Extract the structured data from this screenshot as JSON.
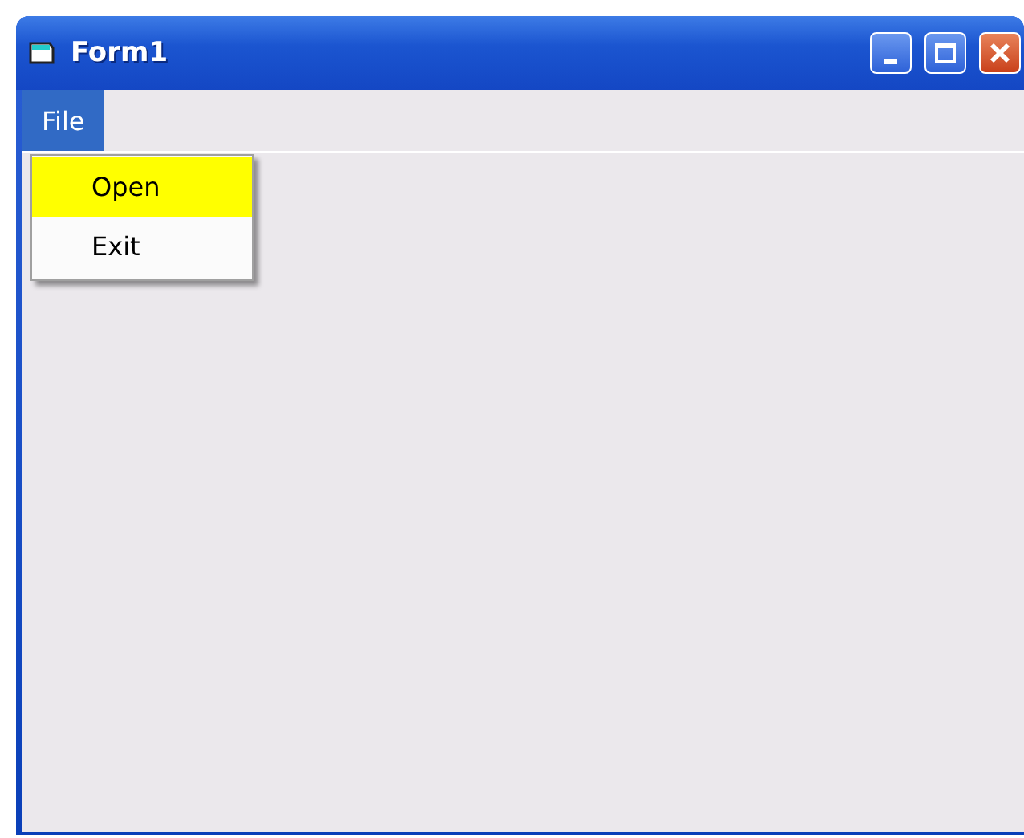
{
  "window": {
    "title": "Form1"
  },
  "menu_bar": [
    {
      "label": "File",
      "selected": true
    }
  ],
  "dropdown": [
    {
      "label": "Open",
      "selected": true
    },
    {
      "label": "Exit",
      "selected": false
    }
  ]
}
